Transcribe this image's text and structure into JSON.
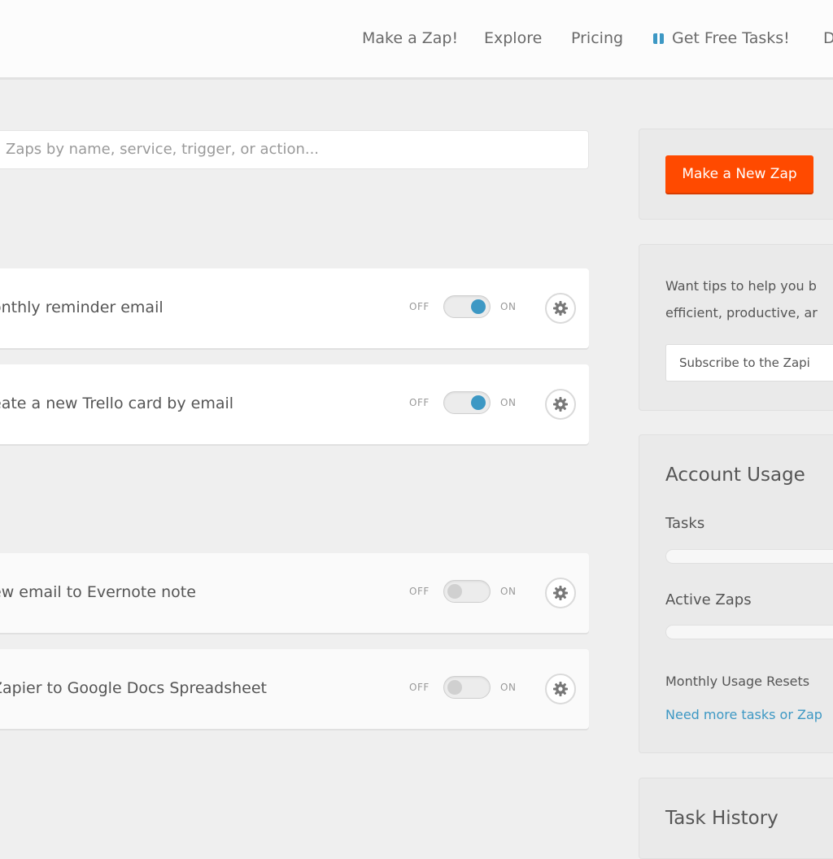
{
  "nav": {
    "items": [
      "Make a Zap!",
      "Explore",
      "Pricing",
      "Get Free Tasks!",
      "D"
    ]
  },
  "search": {
    "placeholder": "Zaps by name, service, trigger, or action..."
  },
  "zaps": [
    {
      "title": "onthly reminder email",
      "state": "on"
    },
    {
      "title": "eate a new Trello card by email",
      "state": "on"
    },
    {
      "title": "ew email to Evernote note",
      "state": "off"
    },
    {
      "title": "Zapier to Google Docs Spreadsheet",
      "state": "off"
    }
  ],
  "toggle": {
    "off_label": "OFF",
    "on_label": "ON"
  },
  "sidebar": {
    "new_zap_button": "Make a New Zap",
    "tips_line1": "Want tips to help you b",
    "tips_line2": "efficient, productive, ar",
    "subscribe_button": "Subscribe to the Zapi",
    "usage_title": "Account Usage",
    "tasks_label": "Tasks",
    "tasks_usage": 0,
    "active_zaps_label": "Active Zaps",
    "active_zaps_usage": 0,
    "resets_text": "Monthly Usage Resets",
    "more_tasks_link": "Need more tasks or Zap",
    "task_history_title": "Task History"
  },
  "colors": {
    "accent": "#3d98c4",
    "brand_orange": "#ff4a00"
  }
}
